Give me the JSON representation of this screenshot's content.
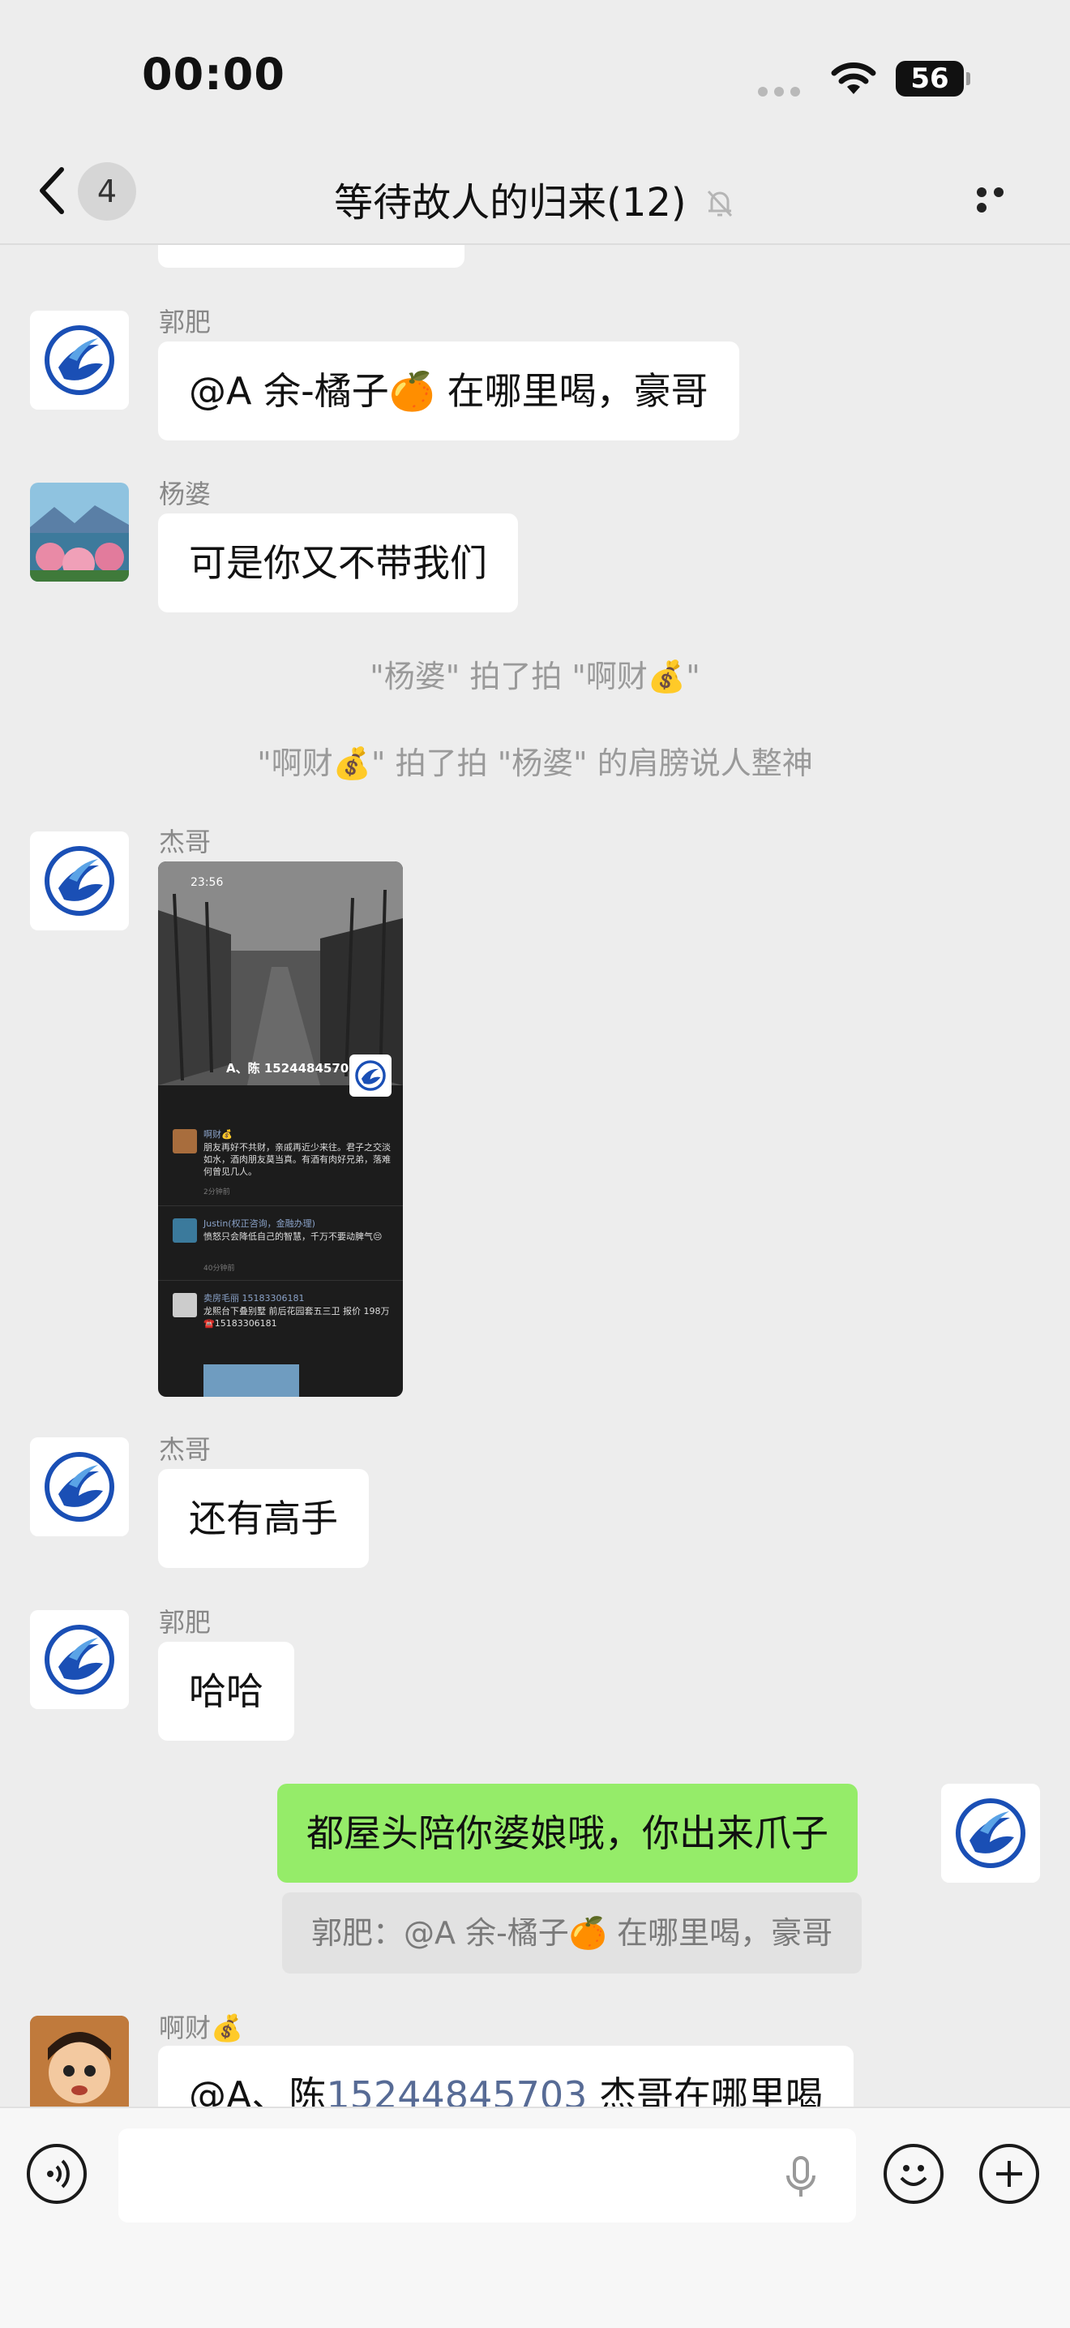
{
  "status": {
    "time": "00:00",
    "battery": "56"
  },
  "nav": {
    "back_count": "4",
    "title": "等待故人的归来(12)"
  },
  "messages": {
    "m1": {
      "sender": "郭肥",
      "text": "@A 余-橘子🍊 在哪里喝，豪哥"
    },
    "m2": {
      "sender": "杨婆",
      "text": "可是你又不带我们"
    },
    "sys1": "\"杨婆\" 拍了拍 \"啊财💰\"",
    "sys2": "\"啊财💰\" 拍了拍 \"杨婆\" 的肩膀说人整神",
    "m3": {
      "sender": "杰哥"
    },
    "m4": {
      "sender": "杰哥",
      "text": "还有高手"
    },
    "m5": {
      "sender": "郭肥",
      "text": "哈哈"
    },
    "m6": {
      "text": "都屋头陪你婆娘哦，你出来爪子",
      "quote": "郭肥：@A 余-橘子🍊 在哪里喝，豪哥"
    },
    "m7": {
      "sender": "啊财💰",
      "text_prefix": "@A、陈",
      "phone": "15244845703",
      "text_suffix": " 杰哥在哪里喝"
    }
  },
  "screenshot": {
    "time": "23:56",
    "profile_name": "A、陈 15244845703",
    "posts": [
      {
        "author": "啊财💰",
        "text": "朋友再好不共财，亲戚再近少来往。君子之交淡如水，酒肉朋友莫当真。有酒有肉好兄弟，落难何曾见几人。",
        "time": "2分钟前"
      },
      {
        "author": "Justin(权正咨询，金融办理)",
        "text": "愤怒只会降低自己的智慧，千万不要动脾气😔",
        "time": "40分钟前"
      },
      {
        "author": "卖房毛丽 15183306181",
        "text": "龙熙台下叠别墅 前后花园套五三卫 报价 198万 ☎️15183306181",
        "time": ""
      }
    ]
  },
  "colors": {
    "me_bubble": "#95ec69",
    "phone_link": "#576b95"
  }
}
